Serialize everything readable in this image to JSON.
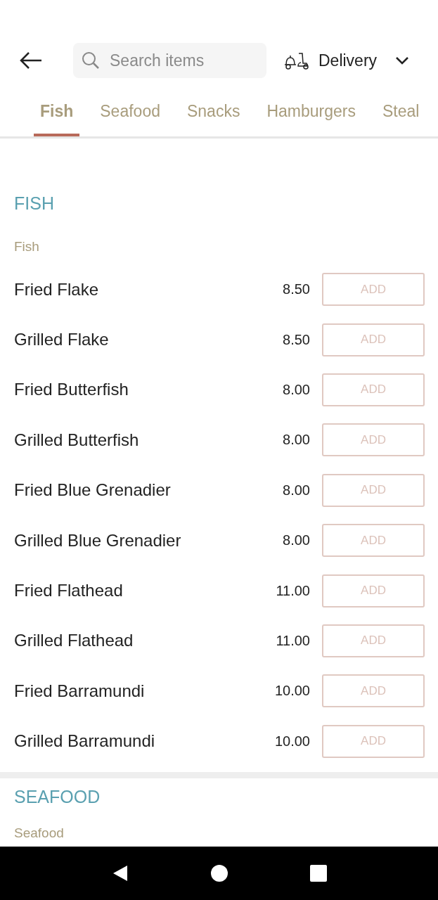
{
  "header": {
    "search": {
      "placeholder": "Search items"
    },
    "mode": "Delivery"
  },
  "tabs": [
    {
      "label": "Fish",
      "selected": true
    },
    {
      "label": "Seafood",
      "selected": false
    },
    {
      "label": "Snacks",
      "selected": false
    },
    {
      "label": "Hamburgers",
      "selected": false
    },
    {
      "label": "Steal",
      "selected": false
    }
  ],
  "sections": [
    {
      "title": "FISH",
      "subtitle": "Fish",
      "items": [
        {
          "name": "Fried Flake",
          "price": "8.50",
          "button": "ADD"
        },
        {
          "name": "Grilled Flake",
          "price": "8.50",
          "button": "ADD"
        },
        {
          "name": "Fried Butterfish",
          "price": "8.00",
          "button": "ADD"
        },
        {
          "name": "Grilled Butterfish",
          "price": "8.00",
          "button": "ADD"
        },
        {
          "name": "Fried Blue Grenadier",
          "price": "8.00",
          "button": "ADD"
        },
        {
          "name": "Grilled Blue Grenadier",
          "price": "8.00",
          "button": "ADD"
        },
        {
          "name": "Fried Flathead",
          "price": "11.00",
          "button": "ADD"
        },
        {
          "name": "Grilled Flathead",
          "price": "11.00",
          "button": "ADD"
        },
        {
          "name": "Fried Barramundi",
          "price": "10.00",
          "button": "ADD"
        },
        {
          "name": "Grilled Barramundi",
          "price": "10.00",
          "button": "ADD"
        }
      ]
    },
    {
      "title": "SEAFOOD",
      "subtitle": "Seafood"
    }
  ]
}
